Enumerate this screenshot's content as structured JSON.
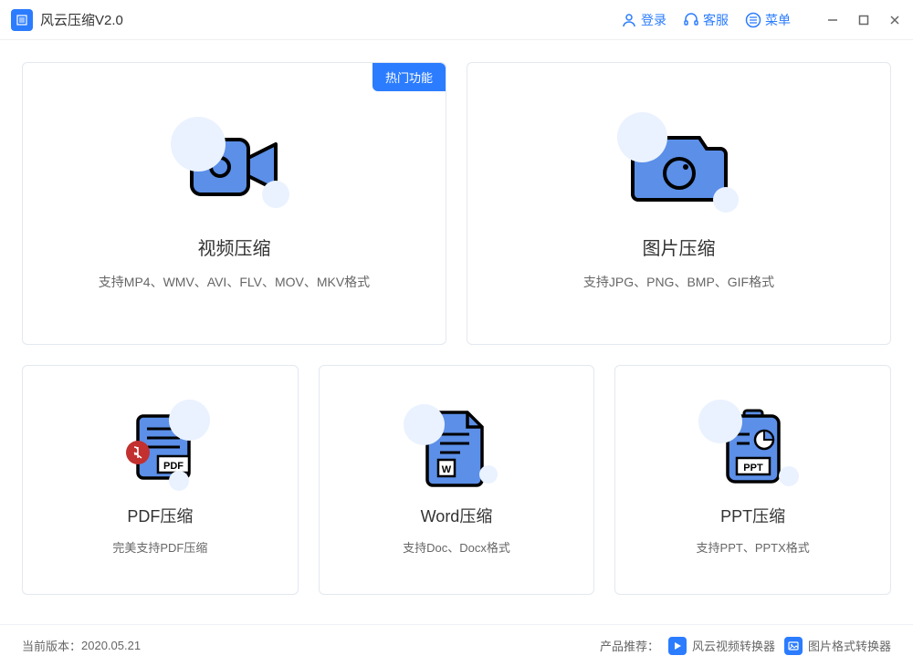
{
  "app": {
    "title": "风云压缩V2.0"
  },
  "titlebar": {
    "login": "登录",
    "support": "客服",
    "menu": "菜单"
  },
  "cards": {
    "video": {
      "badge": "热门功能",
      "title": "视频压缩",
      "desc": "支持MP4、WMV、AVI、FLV、MOV、MKV格式"
    },
    "image": {
      "title": "图片压缩",
      "desc": "支持JPG、PNG、BMP、GIF格式"
    },
    "pdf": {
      "title": "PDF压缩",
      "desc": "完美支持PDF压缩"
    },
    "word": {
      "title": "Word压缩",
      "desc": "支持Doc、Docx格式"
    },
    "ppt": {
      "title": "PPT压缩",
      "desc": "支持PPT、PPTX格式"
    }
  },
  "footer": {
    "version_label": "当前版本：",
    "version_value": "2020.05.21",
    "recommend_label": "产品推荐：",
    "rec1": "风云视频转换器",
    "rec2": "图片格式转换器"
  }
}
